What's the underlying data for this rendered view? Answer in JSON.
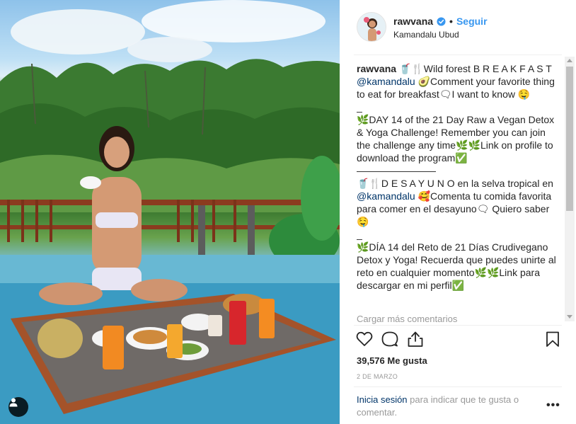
{
  "post": {
    "username": "rawvana",
    "follow_label": "Seguir",
    "separator": "•",
    "location": "Kamandalu Ubud"
  },
  "caption": {
    "author": "rawvana",
    "lines": [
      " 🥤🍴Wild forest B R E A K F A S T",
      "@kamandalu",
      " 🥑Comment your favorite thing to eat for breakfast🗨I want to know 🤤",
      "_",
      "🌿DAY 14 of the 21 Day Raw a Vegan Detox & Yoga Challenge! Remember you can join the challenge any time🌿🌿Link on profile to download the program✅",
      "————————",
      "🥤🍴D E S A Y U N O en la selva tropical en ",
      "@kamandalu",
      " 🥰Comenta tu comida favorita para comer en el desayuno🗨 Quiero saber🤤",
      "_",
      "🌿DÍA 14 del Reto de 21 Días Crudivegano Detox y Yoga! Recuerda que puedes unirte al reto en cualquier momento🌿🌿Link para descargar en mi perfil✅"
    ]
  },
  "load_more": "Cargar más comentarios",
  "likes": "39,576 Me gusta",
  "date": "2 DE MARZO",
  "login": {
    "link": "Inicia sesión",
    "text": " para indicar que te gusta o comentar."
  },
  "more_options": "•••",
  "colors": {
    "accent": "#3897f0",
    "link": "#003569",
    "muted": "#999999",
    "text": "#262626"
  },
  "icons": {
    "like": "heart-icon",
    "comment": "comment-icon",
    "share": "share-icon",
    "save": "bookmark-icon",
    "verified": "verified-badge-icon",
    "user_tag": "user-tag-icon"
  }
}
